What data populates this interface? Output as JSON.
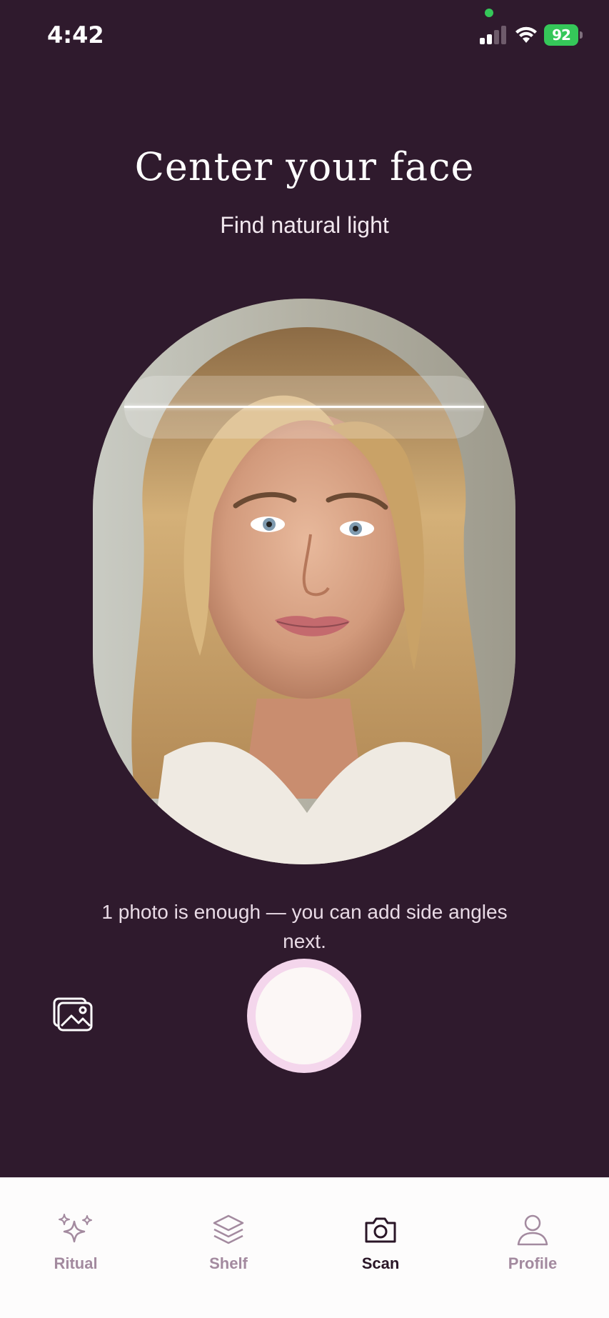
{
  "status_bar": {
    "time": "4:42",
    "battery": "92"
  },
  "header": {
    "title": "Center your face",
    "subtitle": "Find natural light"
  },
  "hint": "1 photo is enough — you can add side angles next.",
  "controls": {
    "gallery_icon": "image-gallery-icon",
    "shutter_icon": "shutter-button"
  },
  "tabs": [
    {
      "label": "Ritual",
      "icon": "sparkles-icon",
      "active": false
    },
    {
      "label": "Shelf",
      "icon": "layers-icon",
      "active": false
    },
    {
      "label": "Scan",
      "icon": "camera-icon",
      "active": true
    },
    {
      "label": "Profile",
      "icon": "person-icon",
      "active": false
    }
  ],
  "colors": {
    "background": "#2f1a2d",
    "accent": "#f4d6ec",
    "tab_inactive": "#a38a9f",
    "tab_active": "#2a1627",
    "battery": "#35c759"
  }
}
